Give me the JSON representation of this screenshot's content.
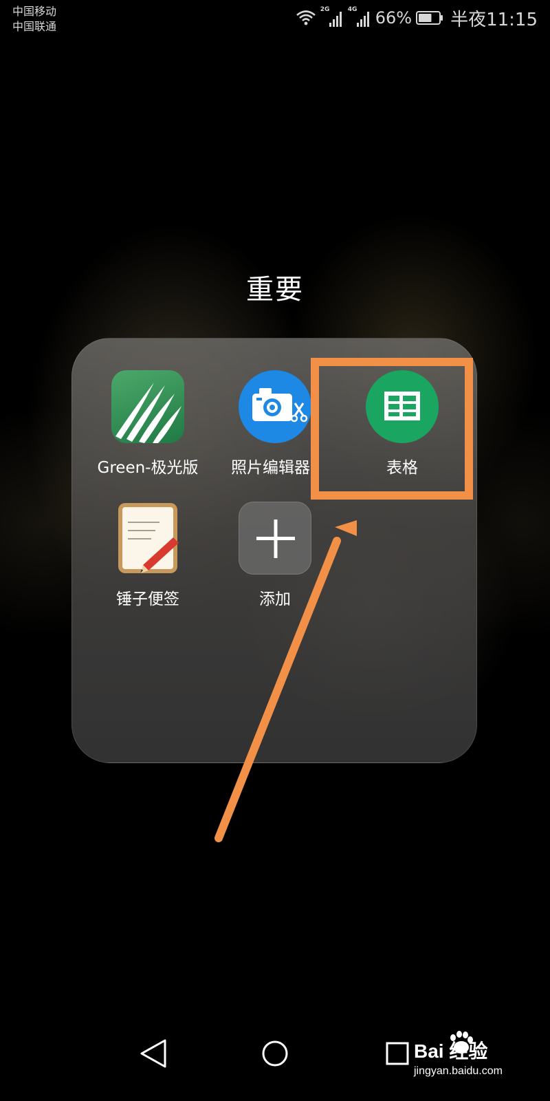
{
  "status_bar": {
    "carrier_1": "中国移动",
    "carrier_2": "中国联通",
    "sim1_network": "2G",
    "sim2_network": "4G",
    "battery_percent": "66%",
    "battery_level": 0.66,
    "time": "半夜11:15"
  },
  "folder": {
    "title": "重要",
    "apps": [
      {
        "label": "Green-极光版",
        "icon": "green-leaf-icon"
      },
      {
        "label": "照片编辑器",
        "icon": "camera-scissors-icon"
      },
      {
        "label": "表格",
        "icon": "spreadsheet-icon"
      },
      {
        "label": "锤子便签",
        "icon": "notepad-pencil-icon"
      },
      {
        "label": "添加",
        "icon": "plus-icon"
      }
    ]
  },
  "highlight": {
    "color": "#f39048",
    "target": "表格"
  },
  "nav_bar": {
    "back": "back-triangle-icon",
    "home": "home-circle-icon",
    "recent": "recent-square-icon"
  },
  "watermark": {
    "brand": "Bai 经验",
    "url": "jingyan.baidu.com"
  }
}
